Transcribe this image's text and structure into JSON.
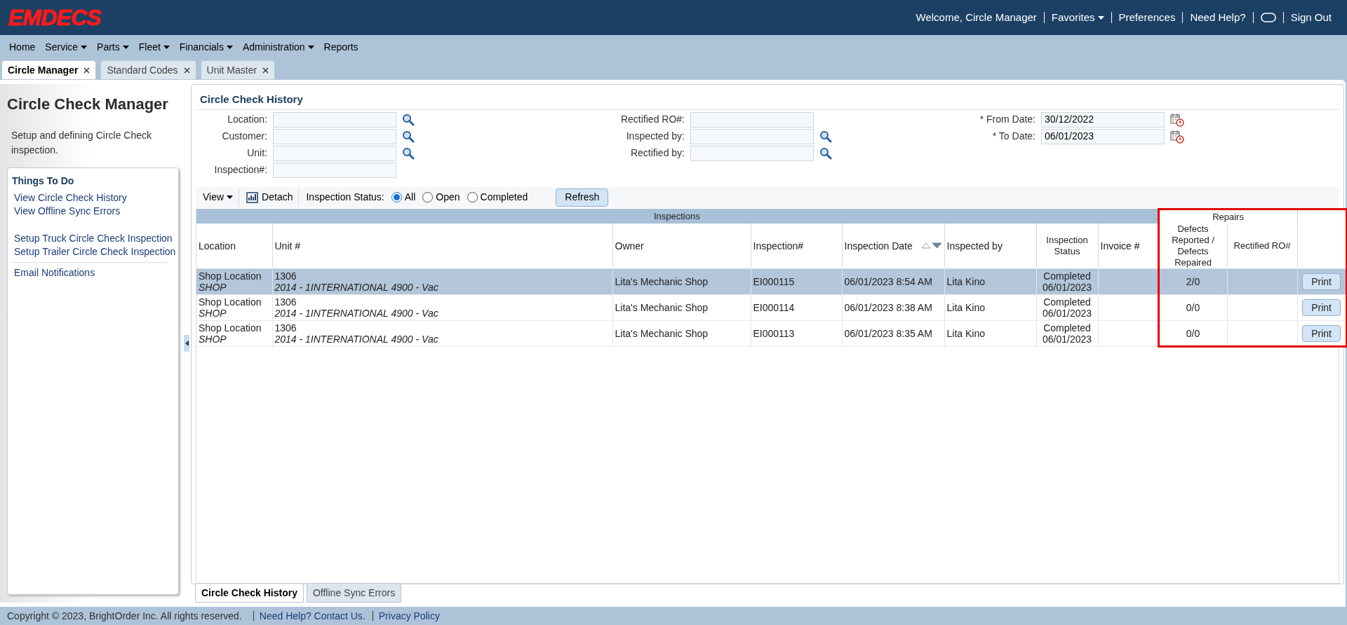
{
  "header": {
    "logo": "EMDECS",
    "user_links": [
      {
        "kind": "text",
        "label": "Welcome, Circle Manager"
      },
      {
        "kind": "menu",
        "label": "Favorites"
      },
      {
        "kind": "link",
        "label": "Preferences"
      },
      {
        "kind": "link",
        "label": "Need Help?"
      },
      {
        "kind": "icon"
      },
      {
        "kind": "link",
        "label": "Sign Out"
      }
    ]
  },
  "menu": [
    {
      "label": "Home",
      "has_menu": false
    },
    {
      "label": "Service",
      "has_menu": true
    },
    {
      "label": "Parts",
      "has_menu": true
    },
    {
      "label": "Fleet",
      "has_menu": true
    },
    {
      "label": "Financials",
      "has_menu": true
    },
    {
      "label": "Administration",
      "has_menu": true
    },
    {
      "label": "Reports",
      "has_menu": false
    }
  ],
  "tabs": [
    {
      "label": "Circle Manager",
      "selected": true
    },
    {
      "label": "Standard Codes",
      "selected": false
    },
    {
      "label": "Unit Master",
      "selected": false
    }
  ],
  "sidebar": {
    "title": "Circle Check Manager",
    "description": "Setup and defining Circle Check inspection.",
    "things_to_do": {
      "title": "Things To Do",
      "groups": [
        {
          "divider_above": false,
          "items": [
            "View Circle Check History",
            "View Offline Sync Errors"
          ]
        },
        {
          "divider_above": false,
          "items": [
            "Setup Truck Circle Check Inspection",
            "Setup Trailer Circle Check Inspection"
          ]
        },
        {
          "divider_above": true,
          "items": [
            "Email Notifications"
          ]
        }
      ]
    }
  },
  "panel": {
    "title": "Circle Check History",
    "filters": [
      [
        {
          "label": "Location:",
          "lookup": true
        },
        {
          "label": "Customer:",
          "lookup": true
        },
        {
          "label": "Unit:",
          "lookup": true
        },
        {
          "label": "Inspection#:",
          "lookup": false
        }
      ],
      [
        {
          "label": "Rectified RO#:",
          "lookup": false
        },
        {
          "label": "Inspected by:",
          "lookup": true
        },
        {
          "label": "Rectified by:",
          "lookup": true
        }
      ],
      [
        {
          "label": "* From Date:",
          "value": "30/12/2022",
          "calendar": true
        },
        {
          "label": "* To Date:",
          "value": "06/01/2023",
          "calendar": true
        }
      ]
    ],
    "toolbar": {
      "view": "View",
      "detach": "Detach",
      "status_label": "Inspection Status:",
      "status_options": [
        {
          "label": "All",
          "selected": true
        },
        {
          "label": "Open",
          "selected": false
        },
        {
          "label": "Completed",
          "selected": false
        }
      ],
      "refresh": "Refresh"
    },
    "table": {
      "groups": [
        {
          "label": "Inspections",
          "highlighted": false,
          "columns": [
            {
              "label": "Location"
            },
            {
              "label": "Unit #"
            },
            {
              "label": "Owner"
            },
            {
              "label": "Inspection#"
            },
            {
              "label": "Inspection Date",
              "sorted_descending": true
            },
            {
              "label": "Inspected by"
            },
            {
              "label": "Inspection Status"
            },
            {
              "label": "Invoice #"
            }
          ]
        },
        {
          "label": "Repairs",
          "highlighted": true,
          "columns": [
            {
              "label": "Defects Reported / Defects Repaired"
            },
            {
              "label": "Rectified RO#"
            }
          ]
        },
        {
          "highlighted": true,
          "columns": [
            {
              "kind": "action"
            }
          ]
        }
      ],
      "rows": [
        {
          "selected": true,
          "location": "Shop Location",
          "location_code": "SHOP",
          "unit": "1306",
          "unit_desc": "2014 - 1INTERNATIONAL 4900 - Vac",
          "owner": "Lita's Mechanic Shop",
          "inspection": "EI000115",
          "date": "06/01/2023 8:54 AM",
          "inspected_by": "Lita Kino",
          "status": "Completed",
          "status_date": "06/01/2023",
          "defects": "2/0",
          "action": "Print"
        },
        {
          "selected": false,
          "location": "Shop Location",
          "location_code": "SHOP",
          "unit": "1306",
          "unit_desc": "2014 - 1INTERNATIONAL 4900 - Vac",
          "owner": "Lita's Mechanic Shop",
          "inspection": "EI000114",
          "date": "06/01/2023 8:38 AM",
          "inspected_by": "Lita Kino",
          "status": "Completed",
          "status_date": "06/01/2023",
          "defects": "0/0",
          "action": "Print"
        },
        {
          "selected": false,
          "location": "Shop Location",
          "location_code": "SHOP",
          "unit": "1306",
          "unit_desc": "2014 - 1INTERNATIONAL 4900 - Vac",
          "owner": "Lita's Mechanic Shop",
          "inspection": "EI000113",
          "date": "06/01/2023 8:35 AM",
          "inspected_by": "Lita Kino",
          "status": "Completed",
          "status_date": "06/01/2023",
          "defects": "0/0",
          "action": "Print"
        }
      ]
    },
    "bottom_tabs": [
      {
        "label": "Circle Check History",
        "selected": true
      },
      {
        "label": "Offline Sync Errors",
        "selected": false
      }
    ]
  },
  "footer": {
    "copyright": "Copyright © 2023, BrightOrder Inc. All rights reserved.",
    "links": [
      "Need Help? Contact Us.",
      "Privacy Policy"
    ]
  }
}
